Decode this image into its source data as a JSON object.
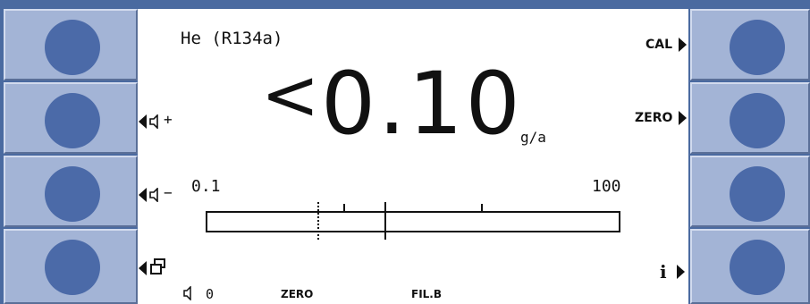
{
  "gas_label": "He (R134a)",
  "reading": {
    "qualifier": "<",
    "value": "0.10",
    "unit": "g/a"
  },
  "softkeys": {
    "right_top_label": "CAL",
    "right_second_label": "ZERO",
    "right_bottom_icon": "info-icon",
    "left_second_icon": "volume-up-icon",
    "left_third_icon": "volume-down-icon",
    "left_bottom_icon": "windows-icon"
  },
  "left_labels": {
    "vol_up": "+",
    "vol_down": "−"
  },
  "bargraph": {
    "scale_min": "0.1",
    "scale_max": "100",
    "level_fraction": 0.43,
    "threshold_fraction": 0.27
  },
  "status": {
    "volume_value": "0",
    "zero_label": "ZERO",
    "filter_label": "FIL.B"
  },
  "colors": {
    "bezel": "#4a6aa0",
    "softkey": "#a3b4d6",
    "softkey_dot": "#4b6aa8",
    "screen": "#ffffff"
  }
}
